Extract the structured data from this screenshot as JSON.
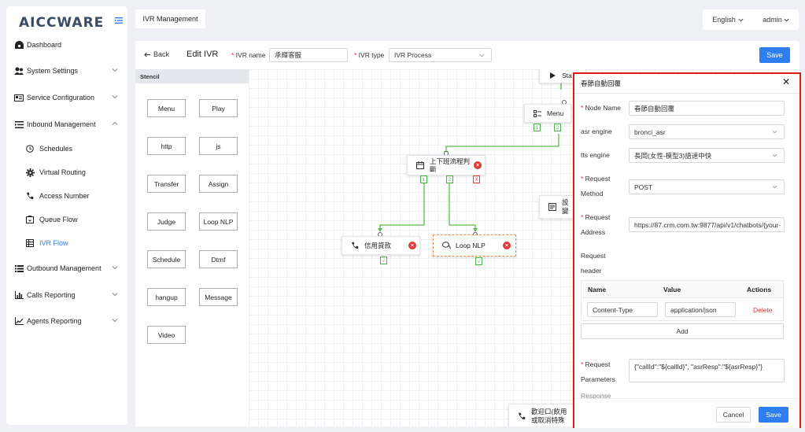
{
  "brand": {
    "logo": "AICCWARE"
  },
  "sidebar": {
    "items": [
      {
        "label": "Dashboard"
      },
      {
        "label": "System Settings"
      },
      {
        "label": "Service Configuration"
      },
      {
        "label": "Inbound Management"
      },
      {
        "label": "Outbound Management"
      },
      {
        "label": "Calls Reporting"
      },
      {
        "label": "Agents Reporting"
      }
    ],
    "inbound_sub": [
      {
        "label": "Schedules"
      },
      {
        "label": "Virtual Routing"
      },
      {
        "label": "Access Number"
      },
      {
        "label": "Queue Flow"
      },
      {
        "label": "IVR Flow"
      }
    ]
  },
  "header": {
    "tab": "IVR Management",
    "language": "English",
    "user": "admin"
  },
  "editor": {
    "back": "Back",
    "title": "Edit IVR",
    "ivr_name_label": "IVR name",
    "ivr_name_value": "承輝客服",
    "ivr_type_label": "IVR type",
    "ivr_type_value": "IVR Process",
    "save": "Save"
  },
  "stencil": {
    "title": "Stencil",
    "buttons": [
      "Menu",
      "Play",
      "http",
      "js",
      "Transfer",
      "Assign",
      "Judge",
      "Loop NLP",
      "Schedule",
      "Dtmf",
      "hangup",
      "Message",
      "Video"
    ]
  },
  "canvas": {
    "nodes": {
      "start": "Sta",
      "menu": "Menu",
      "judge_line1": "上下班流程判",
      "judge_line2": "斷",
      "credit": "信用貸款",
      "loop": "Loop NLP",
      "setting1": "設",
      "setting2": "變",
      "welcome1": "歡迎口(飲用",
      "welcome2": "或取消特殊"
    },
    "ports": {
      "p1": "1",
      "p2": "2",
      "x": "X",
      "check": "√"
    },
    "delete_glyph": "×"
  },
  "panel": {
    "title": "春節自動回覆",
    "close": "✕",
    "node_name_label": "Node Name",
    "node_name_value": "春節自動回覆",
    "asr_label": "asr engine",
    "asr_value": "bronci_asr",
    "tts_label": "tts engine",
    "tts_value": "長岡(女性-模型3)語速中快",
    "method_label_1": "Request",
    "method_label_2": "Method",
    "method_value": "POST",
    "address_label_1": "Request",
    "address_label_2": "Address",
    "address_value": "https://87.crm.com.tw:9877/api/v1/chatbots/{your-",
    "header_label_1": "Request",
    "header_label_2": "header",
    "table_headers": [
      "Name",
      "Value",
      "Actions"
    ],
    "header_name": "Content-Type",
    "header_value": "application/json",
    "delete": "Delete",
    "add": "Add",
    "params_label_1": "Request",
    "params_label_2": "Parameters",
    "params_value": "{\"callId\":\"${callId}\", \"asrResp\":\"${asrResp}\"}",
    "response_label": "Response",
    "cancel": "Cancel",
    "save": "Save"
  },
  "colors": {
    "accent": "#2f7ef0",
    "danger": "#e23a3a",
    "connector": "#5dbb4e",
    "highlight": "#e0191b"
  }
}
